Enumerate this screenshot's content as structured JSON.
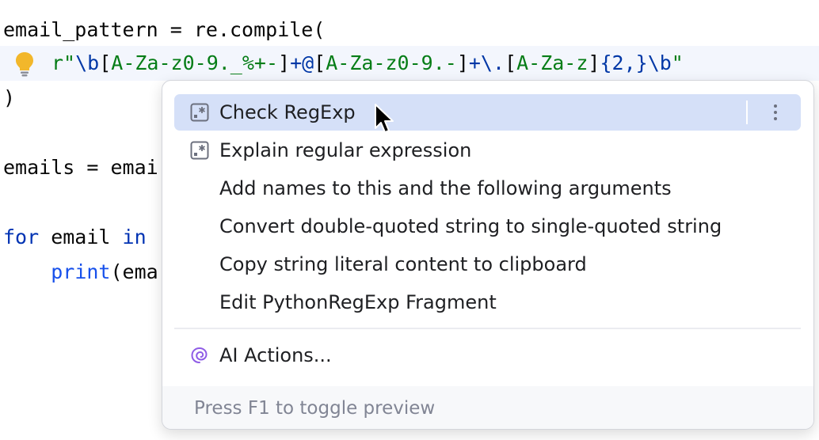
{
  "editor": {
    "line1": {
      "var": "email_pattern",
      "op": " = ",
      "obj": "re",
      "dot": ".",
      "fn": "compile",
      "paren": "("
    },
    "line2": {
      "prefix": "r\"",
      "p1": "\\b",
      "p2": "[",
      "p3": "A-Za-z0-9._%+-",
      "p4": "]",
      "p5": "+@",
      "p6": "[",
      "p7": "A-Za-z0-9.-",
      "p8": "]",
      "p9": "+\\.",
      "p10": "[",
      "p11": "A-Za-z",
      "p12": "]",
      "p13": "{2,}",
      "p14": "\\b",
      "suffix": "\""
    },
    "line3": ")",
    "line4": "emails = emai",
    "line5": {
      "kw_for": "for",
      "var": " email ",
      "kw_in": "in"
    },
    "line6": {
      "indent": "    ",
      "fn": "print",
      "rest": "(ema"
    },
    "bulb_icon": "lightbulb-icon"
  },
  "popup": {
    "items": [
      {
        "label": "Check RegExp",
        "icon": "regexp-icon",
        "selected": true
      },
      {
        "label": "Explain regular expression",
        "icon": "regexp-icon"
      },
      {
        "label": "Add names to this and the following arguments"
      },
      {
        "label": "Convert double-quoted string to single-quoted string"
      },
      {
        "label": "Copy string literal content to clipboard"
      },
      {
        "label": "Edit PythonRegExp Fragment"
      }
    ],
    "ai_item": {
      "label": "AI Actions...",
      "icon": "ai-spiral-icon"
    },
    "more_icon": "more-vertical-icon",
    "footer": "Press F1 to toggle preview"
  },
  "colors": {
    "selection": "#d5e0f8",
    "keyword": "#0033b3",
    "string": "#067d17",
    "ai_accent": "#8f5ce6",
    "bulb": "#f2b72b"
  }
}
